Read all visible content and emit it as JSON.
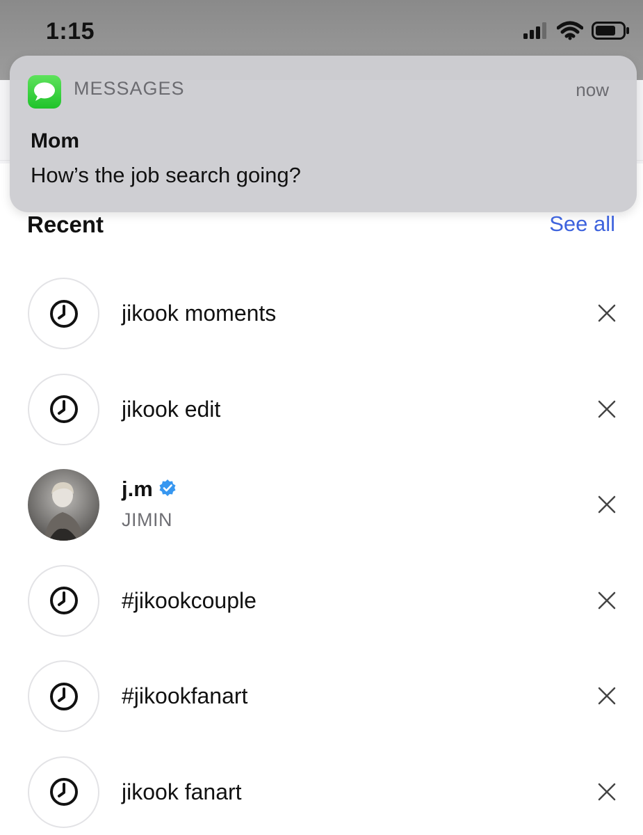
{
  "status_bar": {
    "time": "1:15",
    "icons": [
      "cellular-signal-icon",
      "wifi-icon",
      "battery-icon"
    ]
  },
  "notification": {
    "app_name": "MESSAGES",
    "app_icon": "messages-bubble-icon",
    "time": "now",
    "sender": "Mom",
    "body": "How’s the job search going?"
  },
  "recent": {
    "title": "Recent",
    "see_all": "See all"
  },
  "items": [
    {
      "type": "search",
      "icon": "clock-icon",
      "label": "jikook moments"
    },
    {
      "type": "search",
      "icon": "clock-icon",
      "label": "jikook edit"
    },
    {
      "type": "account",
      "username": "j.m",
      "verified": true,
      "subtitle": "JIMIN"
    },
    {
      "type": "search",
      "icon": "clock-icon",
      "label": "#jikookcouple"
    },
    {
      "type": "search",
      "icon": "clock-icon",
      "label": "#jikookfanart"
    },
    {
      "type": "search",
      "icon": "clock-icon",
      "label": "jikook fanart"
    }
  ],
  "colors": {
    "link": "#3e63dd",
    "verified_badge": "#3797f0",
    "messages_green": "#2ecf3a"
  }
}
